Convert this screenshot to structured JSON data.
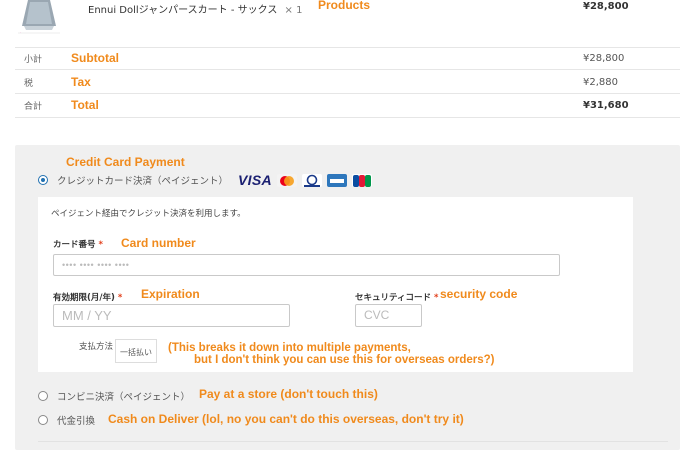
{
  "summary": {
    "product_name": "Ennui Dollジャンパースカート - サックス",
    "product_qty": "× 1",
    "product_price": "¥28,800",
    "rows": [
      {
        "label": "小計",
        "value": "¥28,800"
      },
      {
        "label": "税",
        "value": "¥2,880"
      },
      {
        "label": "合計",
        "value": "¥31,680"
      }
    ]
  },
  "annotations": {
    "products": "Products",
    "subtotal": "Subtotal",
    "tax": "Tax",
    "total": "Total",
    "credit_card_payment": "Credit Card Payment",
    "card_number": "Card number",
    "expiration": "Expiration",
    "security_code": "security code",
    "installments_note_1": "(This breaks it down into multiple payments,",
    "installments_note_2": "but I don't think you can use this for overseas orders?)",
    "convenience_store": "Pay at a store (don't touch this)",
    "cod": "Cash on Deliver (lol, no you can't do this overseas, don't try it)"
  },
  "payment": {
    "methods": [
      {
        "label": "クレジットカード決済（ペイジェント）",
        "selected": true
      },
      {
        "label": "コンビニ決済（ペイジェント）",
        "selected": false
      },
      {
        "label": "代金引換",
        "selected": false
      }
    ],
    "card_logos": [
      "visa-logo",
      "mastercard-logo",
      "diners-club-logo",
      "amex-logo",
      "jcb-logo"
    ],
    "visa_text": "VISA",
    "description": "ペイジェント経由でクレジット決済を利用します。",
    "card_number_label": "カード番号",
    "card_number_placeholder": "•••• •••• •••• ••••",
    "expiry_label": "有効期限(月/年)",
    "expiry_placeholder": "MM / YY",
    "cvc_label": "セキュリティコード",
    "cvc_placeholder": "CVC",
    "required_mark": "*",
    "installments_label": "支払方法",
    "installments_value": "一括払い"
  },
  "colors": {
    "annotation": "#f08a1c",
    "required": "#e2401c",
    "radio_selected": "#2271b1"
  }
}
